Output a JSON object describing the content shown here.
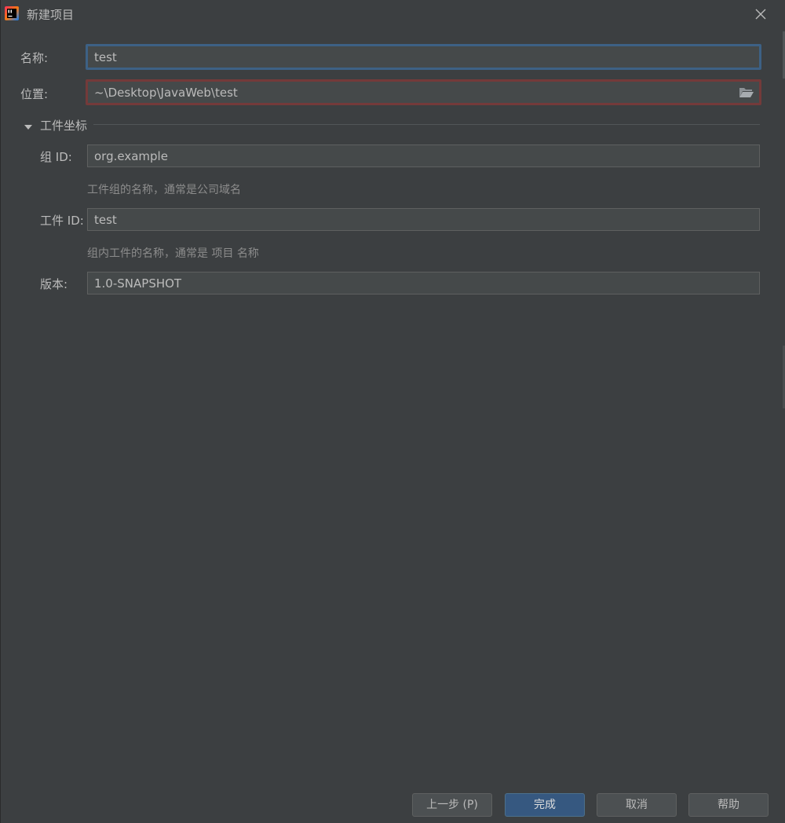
{
  "window": {
    "title": "新建项目",
    "icons": {
      "app": "intellij-idea-icon",
      "close": "close-icon"
    }
  },
  "form": {
    "name": {
      "label": "名称:",
      "value": "test"
    },
    "location": {
      "label": "位置:",
      "value": "~\\Desktop\\JavaWeb\\test",
      "icon": "folder-open-icon"
    }
  },
  "artifact_section": {
    "title": "工件坐标",
    "expanded": true,
    "group_id": {
      "label": "组 ID:",
      "value": "org.example",
      "hint": "工件组的名称，通常是公司域名"
    },
    "artifact_id": {
      "label": "工件 ID:",
      "value": "test",
      "hint": "组内工件的名称，通常是 项目 名称"
    },
    "version": {
      "label": "版本:",
      "value": "1.0-SNAPSHOT"
    }
  },
  "buttons": {
    "previous": "上一步 (P)",
    "finish": "完成",
    "cancel": "取消",
    "help": "帮助"
  },
  "colors": {
    "background": "#3c3f41",
    "input_background": "#45494a",
    "focus_border": "#3d6185",
    "error_border": "#743a3a",
    "default_button": "#365880"
  }
}
